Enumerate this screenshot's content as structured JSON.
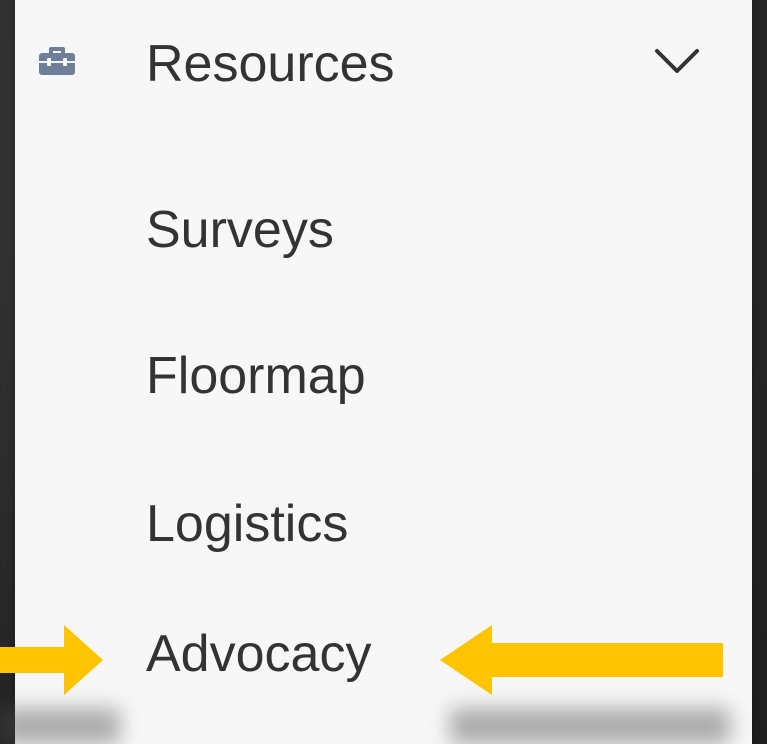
{
  "menu": {
    "header": {
      "label": "Resources",
      "icon": "toolbox-icon",
      "chevron": "chevron-down-icon"
    },
    "items": [
      {
        "label": "Surveys"
      },
      {
        "label": "Floormap"
      },
      {
        "label": "Logistics"
      },
      {
        "label": "Advocacy"
      }
    ]
  },
  "colors": {
    "panel_bg": "#f7f7f7",
    "text": "#333333",
    "icon": "#6f7f99",
    "arrow": "#ffc400",
    "backdrop": "#262626"
  }
}
